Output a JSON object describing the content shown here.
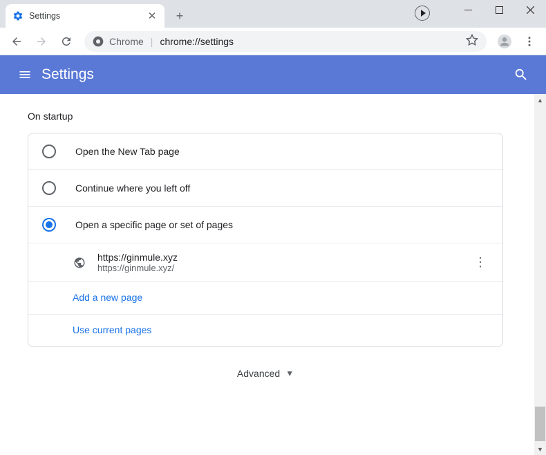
{
  "tab": {
    "title": "Settings"
  },
  "url": {
    "prefix": "Chrome",
    "path": "chrome://settings"
  },
  "header": {
    "title": "Settings"
  },
  "section": {
    "heading": "On startup"
  },
  "radios": {
    "newtab": "Open the New Tab page",
    "continue": "Continue where you left off",
    "specific": "Open a specific page or set of pages"
  },
  "page": {
    "title": "https://ginmule.xyz",
    "url": "https://ginmule.xyz/"
  },
  "links": {
    "add": "Add a new page",
    "current": "Use current pages"
  },
  "advanced": "Advanced"
}
